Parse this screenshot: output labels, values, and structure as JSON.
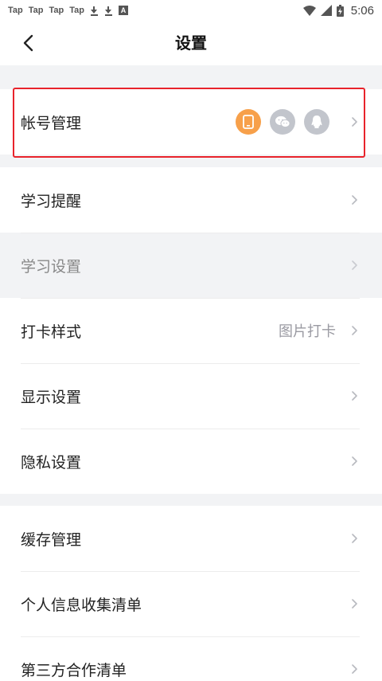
{
  "status_bar": {
    "notifications": [
      "Tap",
      "Tap",
      "Tap",
      "Tap"
    ],
    "time": "5:06"
  },
  "nav": {
    "title": "设置"
  },
  "colors": {
    "accent_orange": "#f7a04a",
    "icon_gray": "#c2c5cc",
    "highlight_red": "#e8232b"
  },
  "sections": [
    {
      "items": [
        {
          "label": "帐号管理",
          "icons": [
            "phone-icon",
            "wechat-icon",
            "qq-icon"
          ]
        }
      ]
    },
    {
      "items": [
        {
          "label": "学习提醒"
        },
        {
          "label": "学习设置"
        },
        {
          "label": "打卡样式",
          "value": "图片打卡"
        },
        {
          "label": "显示设置"
        },
        {
          "label": "隐私设置"
        }
      ]
    },
    {
      "items": [
        {
          "label": "缓存管理"
        },
        {
          "label": "个人信息收集清单"
        },
        {
          "label": "第三方合作清单"
        }
      ]
    }
  ]
}
